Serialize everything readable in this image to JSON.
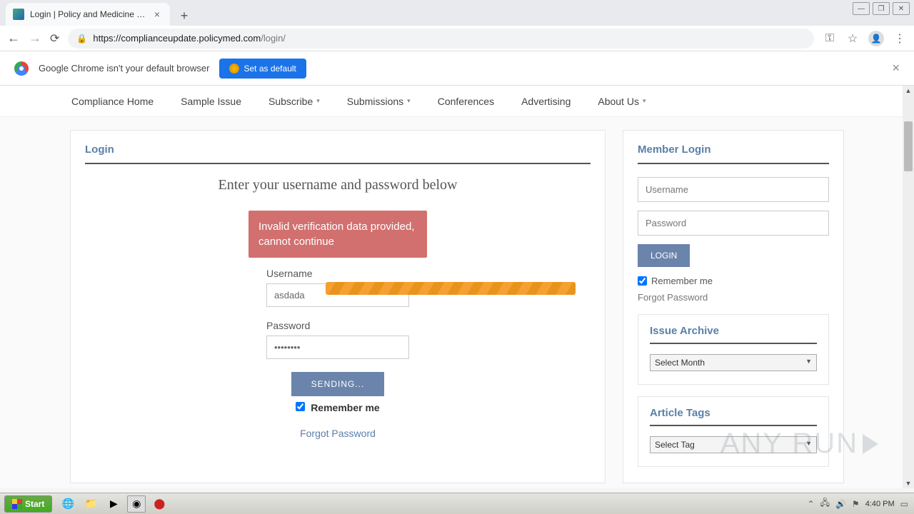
{
  "browser": {
    "tab_title": "Login | Policy and Medicine Complian",
    "url_host": "https://complianceupdate.policymed.com",
    "url_path": "/login/"
  },
  "infobar": {
    "message": "Google Chrome isn't your default browser",
    "button": "Set as default"
  },
  "nav": {
    "items": [
      "Compliance Home",
      "Sample Issue",
      "Subscribe",
      "Submissions",
      "Conferences",
      "Advertising",
      "About Us"
    ],
    "has_caret": [
      false,
      false,
      true,
      true,
      false,
      false,
      true
    ]
  },
  "main": {
    "title": "Login",
    "heading": "Enter your username and password below",
    "error": "Invalid verification data provided, cannot continue",
    "username_label": "Username",
    "username_value": "asdada",
    "password_label": "Password",
    "password_value": "••••••••",
    "submit": "SENDING...",
    "remember": "Remember me",
    "forgot": "Forgot Password"
  },
  "sidebar": {
    "title": "Member Login",
    "username_ph": "Username",
    "password_ph": "Password",
    "login": "LOGIN",
    "remember": "Remember me",
    "forgot": "Forgot Password",
    "archive_title": "Issue Archive",
    "archive_select": "Select Month",
    "tags_title": "Article Tags",
    "tags_select": "Select Tag"
  },
  "taskbar": {
    "start": "Start",
    "time": "4:40 PM"
  },
  "watermark": "ANY    RUN"
}
